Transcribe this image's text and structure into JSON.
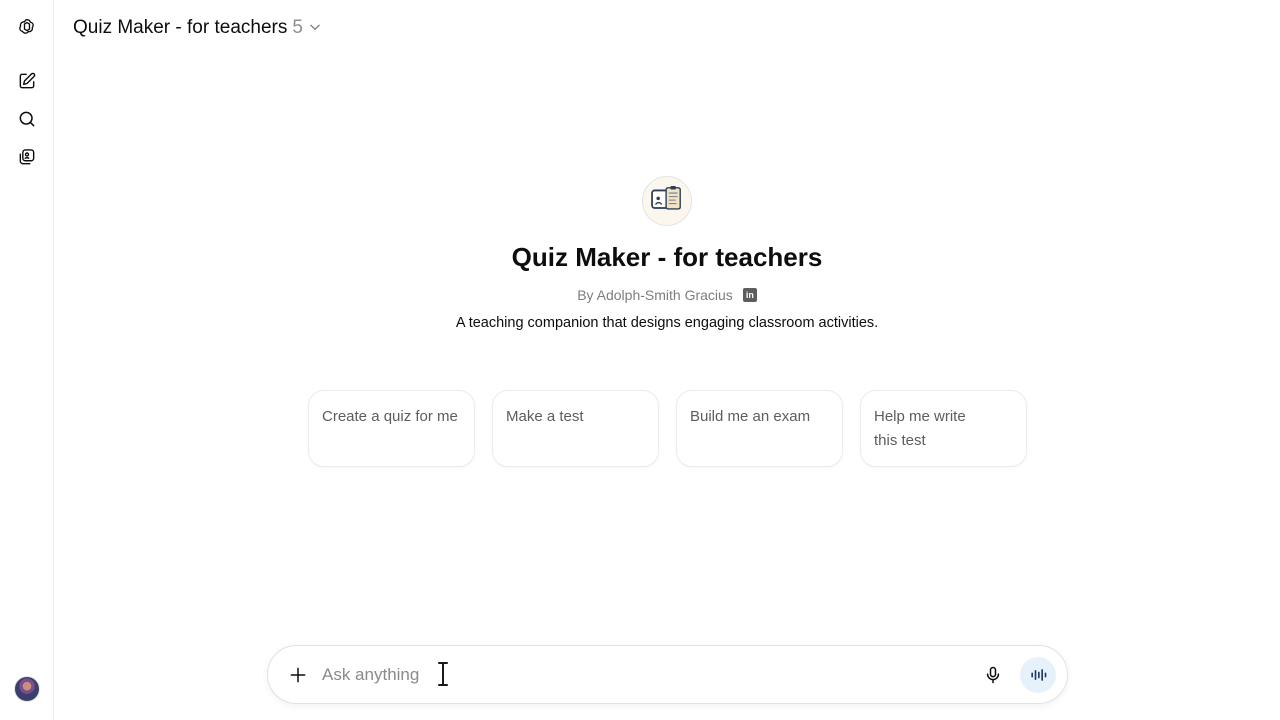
{
  "header": {
    "title": "Quiz Maker - for teachers",
    "version": "5"
  },
  "gpt": {
    "name": "Quiz Maker - for teachers",
    "author": "By Adolph-Smith Gracius",
    "description": "A teaching companion that designs engaging classroom activities."
  },
  "starters": [
    {
      "label": "Create a quiz for me"
    },
    {
      "label": "Make a test"
    },
    {
      "label": "Build me an exam"
    },
    {
      "label": "Help me write this test"
    }
  ],
  "composer": {
    "placeholder": "Ask anything"
  },
  "icons": {
    "logo": "openai-logo-icon",
    "new_chat": "new-chat-icon",
    "search": "search-icon",
    "gpts": "explore-gpts-icon",
    "linkedin": "linkedin-icon",
    "plus": "plus-icon",
    "mic": "microphone-icon",
    "voice": "voice-mode-icon"
  },
  "colors": {
    "voice_button_bg": "#e7f1fb",
    "text_primary": "#0d0d0d",
    "text_secondary": "#7d7d7d"
  }
}
